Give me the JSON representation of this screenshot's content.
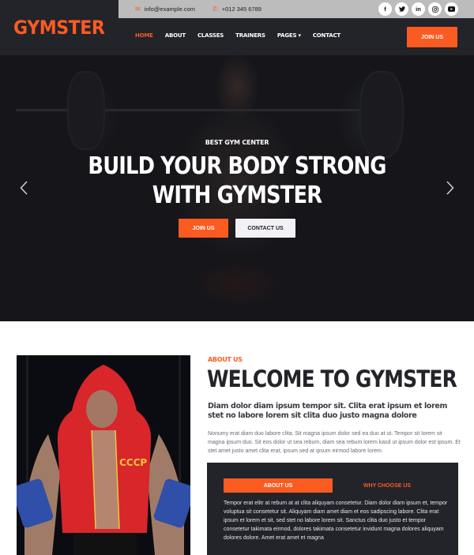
{
  "brand": {
    "name": "GYMSTER",
    "accent": "#FB5B21",
    "dark": "#23232a"
  },
  "topbar": {
    "email": "info@example.com",
    "phone": "+012 345 6789",
    "socials": [
      {
        "name": "facebook",
        "glyph": "f"
      },
      {
        "name": "twitter",
        "glyph": "t"
      },
      {
        "name": "linkedin",
        "glyph": "in"
      },
      {
        "name": "instagram",
        "glyph": "◎"
      },
      {
        "name": "youtube",
        "glyph": "▶"
      }
    ]
  },
  "nav": {
    "items": [
      {
        "label": "HOME",
        "active": true
      },
      {
        "label": "ABOUT",
        "active": false
      },
      {
        "label": "CLASSES",
        "active": false
      },
      {
        "label": "TRAINERS",
        "active": false
      },
      {
        "label": "PAGES ▾",
        "active": false
      },
      {
        "label": "CONTACT",
        "active": false
      }
    ],
    "cta": "JOIN US"
  },
  "hero": {
    "subtitle": "BEST GYM CENTER",
    "title_line1": "BUILD YOUR BODY STRONG",
    "title_line2": "WITH GYMSTER",
    "primary_button": "JOIN US",
    "secondary_button": "CONTACT US",
    "prev_icon": "chevron-left",
    "next_icon": "chevron-right"
  },
  "about": {
    "label": "ABOUT US",
    "title": "WELCOME TO GYMSTER",
    "lead": "Diam dolor diam ipsum tempor sit. Clita erat ipsum et lorem stet no labore lorem sit clita duo justo magna dolore",
    "text": "Nonumy erat diam duo labore clita. Sit magna ipsum dolor sed ea duo at ut. Tempor sit lorem sit magna ipsum duo. Sit eos dolor ut sea rebum, diam sea rebum lorem kasd ut ipsum dolor est ipsum. Et stet amet justo amet clita erat, ipsum sed at ipsum eirmod labore lorem.",
    "tabs": [
      {
        "label": "ABOUT US",
        "active": true
      },
      {
        "label": "WHY CHOOSE US",
        "active": false
      }
    ],
    "tab_content": "Tempor erat elitr at rebum at at clita aliquyam consetetur. Diam dolor diam ipsum et, tempor voluptua sit consetetur sit. Aliquyam diam amet diam et eos sadipscing labore. Clita erat ipsum et lorem et sit, sed stet no labore lorem sit. Sanctus clita duo justo et tempor consetetur takimata eirmod, dolores takimata consetetur invidunt magna dolores aliquyam dolores dolore. Amet erat amet et magna"
  }
}
